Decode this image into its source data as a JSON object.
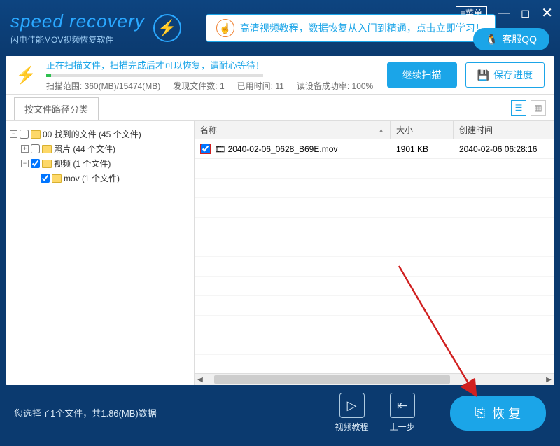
{
  "titlebar": {
    "app_name": "speed recovery",
    "app_sub": "闪电佳能MOV视频恢复软件",
    "promo": "高清视频教程，数据恢复从入门到精通，点击立即学习！",
    "menu_label": "菜单",
    "qq_label": "客服QQ"
  },
  "scan": {
    "status_text": "正在扫描文件，扫描完成后才可以恢复，请耐心等待！",
    "range_label": "扫描范围:",
    "range_value": "360(MB)/15474(MB)",
    "found_label": "发现文件数:",
    "found_value": "1",
    "time_label": "已用时间:",
    "time_value": "11",
    "rate_label": "读设备成功率:",
    "rate_value": "100%",
    "continue_btn": "继续扫描",
    "save_btn": "保存进度"
  },
  "toolbar": {
    "sort_tab": "按文件路径分类"
  },
  "tree": {
    "root": "00 找到的文件  (45 个文件)",
    "photos": "照片    (44 个文件)",
    "videos": "视频    (1 个文件)",
    "mov": "mov    (1 个文件)"
  },
  "columns": {
    "name": "名称",
    "size": "大小",
    "created": "创建时间"
  },
  "files": [
    {
      "name": "2040-02-06_0628_B69E.mov",
      "size": "1901 KB",
      "created": "2040-02-06  06:28:16"
    }
  ],
  "footer": {
    "selection": "您选择了1个文件，共1.86(MB)数据",
    "tutorial": "视频教程",
    "back": "上一步",
    "recover": "恢 复"
  }
}
